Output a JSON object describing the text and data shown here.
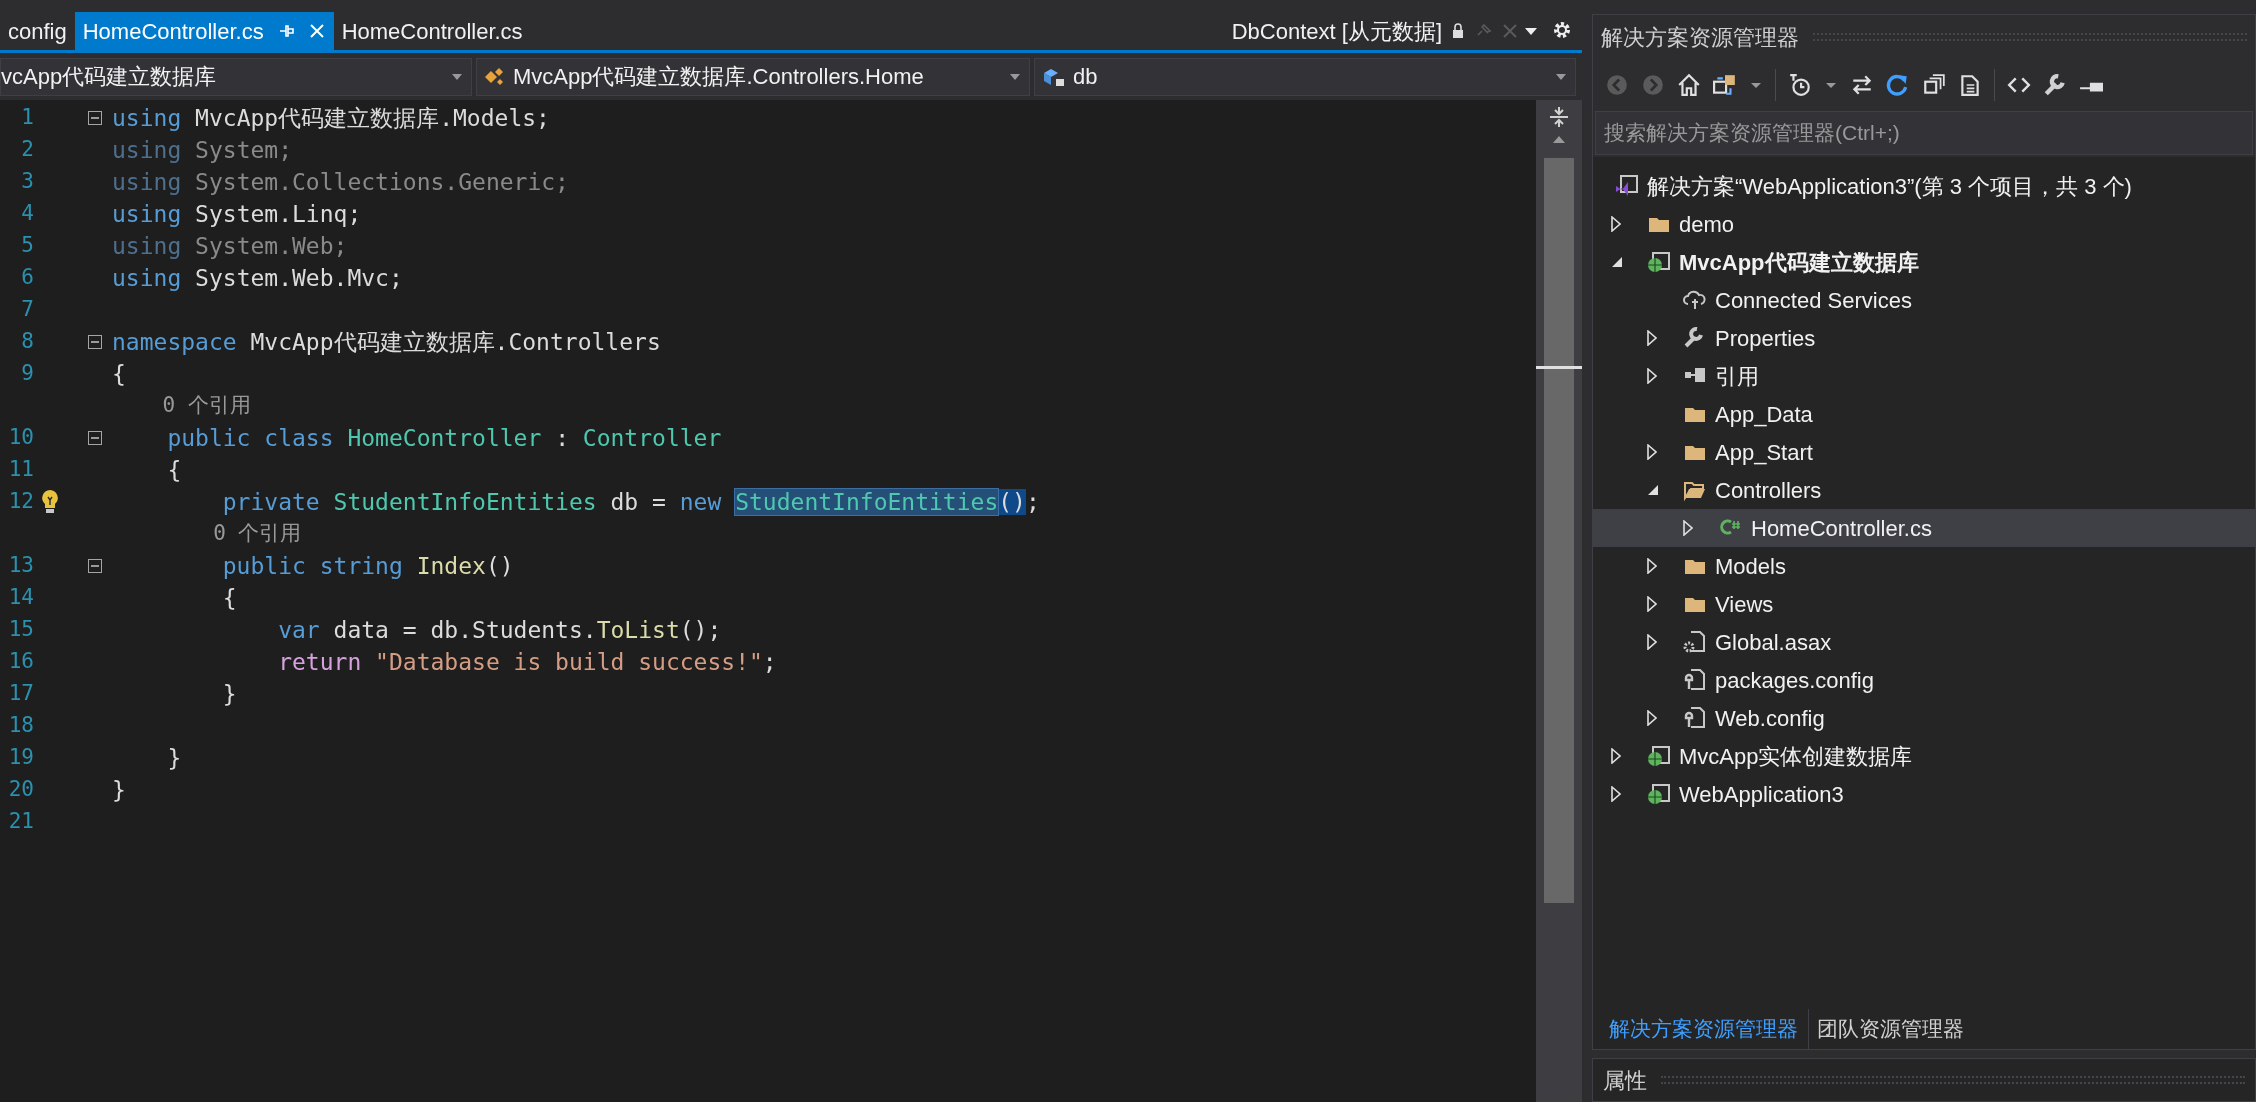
{
  "tabs": [
    {
      "label": "config",
      "selected": false,
      "pinned": false
    },
    {
      "label": "HomeController.cs",
      "selected": true,
      "pinned": true
    },
    {
      "label": "HomeController.cs",
      "selected": false,
      "pinned": false
    }
  ],
  "preview_tab": {
    "label": "DbContext [从元数据]"
  },
  "nav_bar": [
    {
      "label": "vcApp代码建立数据库",
      "kind": "project"
    },
    {
      "label": "MvcApp代码建立数据库.Controllers.Home",
      "kind": "class"
    },
    {
      "label": "db",
      "kind": "field"
    }
  ],
  "code": [
    {
      "kind": "code",
      "number": "1",
      "fold": true,
      "lightbulb": false,
      "tokens": [
        {
          "text": "using ",
          "kind": "keyword"
        },
        {
          "text": "MvcApp代码建立数据库.Models;",
          "kind": "plain"
        }
      ]
    },
    {
      "kind": "code",
      "number": "2",
      "fold": false,
      "lightbulb": false,
      "tokens": [
        {
          "text": "using ",
          "kind": "unusedkeyword"
        },
        {
          "text": "System;",
          "kind": "unused"
        }
      ]
    },
    {
      "kind": "code",
      "number": "3",
      "fold": false,
      "lightbulb": false,
      "tokens": [
        {
          "text": "using ",
          "kind": "unusedkeyword"
        },
        {
          "text": "System.Collections.Generic;",
          "kind": "unused"
        }
      ]
    },
    {
      "kind": "code",
      "number": "4",
      "fold": false,
      "lightbulb": false,
      "tokens": [
        {
          "text": "using ",
          "kind": "keyword"
        },
        {
          "text": "System.Linq;",
          "kind": "plain"
        }
      ]
    },
    {
      "kind": "code",
      "number": "5",
      "fold": false,
      "lightbulb": false,
      "tokens": [
        {
          "text": "using ",
          "kind": "unusedkeyword"
        },
        {
          "text": "System.Web;",
          "kind": "unused"
        }
      ]
    },
    {
      "kind": "code",
      "number": "6",
      "fold": false,
      "lightbulb": false,
      "tokens": [
        {
          "text": "using ",
          "kind": "keyword"
        },
        {
          "text": "System.Web.Mvc;",
          "kind": "plain"
        }
      ]
    },
    {
      "kind": "code",
      "number": "7",
      "fold": false,
      "lightbulb": false
    },
    {
      "kind": "code",
      "number": "8",
      "fold": true,
      "lightbulb": false,
      "tokens": [
        {
          "text": "namespace ",
          "kind": "keyword"
        },
        {
          "text": "MvcApp代码建立数据库.Controllers",
          "kind": "plain"
        }
      ]
    },
    {
      "kind": "code",
      "number": "9",
      "fold": false,
      "lightbulb": false,
      "tokens": [
        {
          "text": "{",
          "kind": "plain"
        }
      ]
    },
    {
      "kind": "lens",
      "text": "    0 个引用"
    },
    {
      "kind": "code",
      "number": "10",
      "fold": true,
      "lightbulb": false,
      "tokens": [
        {
          "text": "    public class ",
          "kind": "keyword"
        },
        {
          "text": "HomeController",
          "kind": "typename"
        },
        {
          "text": " : ",
          "kind": "plain"
        },
        {
          "text": "Controller",
          "kind": "typename"
        }
      ]
    },
    {
      "kind": "code",
      "number": "11",
      "fold": false,
      "lightbulb": false,
      "tokens": [
        {
          "text": "    {",
          "kind": "plain"
        }
      ]
    },
    {
      "kind": "code",
      "number": "12",
      "fold": false,
      "lightbulb": true,
      "tokens": [
        {
          "text": "        private ",
          "kind": "keyword"
        },
        {
          "text": "StudentInfoEntities",
          "kind": "typename"
        },
        {
          "text": " db = ",
          "kind": "plain"
        },
        {
          "text": "new ",
          "kind": "keyword"
        },
        {
          "text": "StudentInfoEntities",
          "kind": "typename",
          "highlighted": true
        },
        {
          "text": "()",
          "kind": "plain",
          "bracket_match": true
        },
        {
          "text": ";",
          "kind": "plain"
        }
      ]
    },
    {
      "kind": "lens",
      "text": "        0 个引用"
    },
    {
      "kind": "code",
      "number": "13",
      "fold": true,
      "lightbulb": false,
      "tokens": [
        {
          "text": "        public string ",
          "kind": "keyword"
        },
        {
          "text": "Index",
          "kind": "method"
        },
        {
          "text": "()",
          "kind": "plain"
        }
      ]
    },
    {
      "kind": "code",
      "number": "14",
      "fold": false,
      "lightbulb": false,
      "tokens": [
        {
          "text": "        {",
          "kind": "plain"
        }
      ]
    },
    {
      "kind": "code",
      "number": "15",
      "fold": false,
      "lightbulb": false,
      "tokens": [
        {
          "text": "            var ",
          "kind": "keyword"
        },
        {
          "text": "data = db.Students.",
          "kind": "plain"
        },
        {
          "text": "ToList",
          "kind": "method"
        },
        {
          "text": "();",
          "kind": "plain"
        }
      ]
    },
    {
      "kind": "code",
      "number": "16",
      "fold": false,
      "lightbulb": false,
      "tokens": [
        {
          "text": "            return ",
          "kind": "control"
        },
        {
          "text": "\"Database is build success!\"",
          "kind": "string"
        },
        {
          "text": ";",
          "kind": "plain"
        }
      ]
    },
    {
      "kind": "code",
      "number": "17",
      "fold": false,
      "lightbulb": false,
      "tokens": [
        {
          "text": "        }",
          "kind": "plain"
        }
      ]
    },
    {
      "kind": "code",
      "number": "18",
      "fold": false,
      "lightbulb": false
    },
    {
      "kind": "code",
      "number": "19",
      "fold": false,
      "lightbulb": false,
      "tokens": [
        {
          "text": "    }",
          "kind": "plain"
        }
      ]
    },
    {
      "kind": "code",
      "number": "20",
      "fold": false,
      "lightbulb": false,
      "tokens": [
        {
          "text": "}",
          "kind": "plain"
        }
      ]
    },
    {
      "kind": "code",
      "number": "21",
      "fold": false,
      "lightbulb": false
    }
  ],
  "solution_explorer": {
    "title": "解决方案资源管理器",
    "search": {
      "placeholder": "搜索解决方案资源管理器(Ctrl+;)"
    },
    "tree": [
      {
        "label": "解决方案“WebApplication3”(第 3 个项目，共 3 个)",
        "kind": "solution",
        "bold": false,
        "selected": false,
        "children": [
          {
            "label": "demo",
            "kind": "folder",
            "expandable": true,
            "expanded": false,
            "bold": false,
            "selected": false
          },
          {
            "label": "MvcApp代码建立数据库",
            "kind": "project",
            "expandable": true,
            "expanded": true,
            "bold": true,
            "selected": false,
            "children": [
              {
                "label": "Connected Services",
                "kind": "cloud",
                "expandable": false,
                "bold": false,
                "selected": false
              },
              {
                "label": "Properties",
                "kind": "wrench",
                "expandable": true,
                "expanded": false,
                "bold": false,
                "selected": false
              },
              {
                "label": "引用",
                "kind": "references",
                "expandable": true,
                "expanded": false,
                "bold": false,
                "selected": false
              },
              {
                "label": "App_Data",
                "kind": "folder",
                "expandable": false,
                "bold": false,
                "selected": false
              },
              {
                "label": "App_Start",
                "kind": "folder",
                "expandable": true,
                "expanded": false,
                "bold": false,
                "selected": false
              },
              {
                "label": "Controllers",
                "kind": "openfolder",
                "expandable": true,
                "expanded": true,
                "bold": false,
                "selected": false,
                "children": [
                  {
                    "label": "HomeController.cs",
                    "kind": "csharp",
                    "expandable": true,
                    "expanded": false,
                    "bold": false,
                    "selected": true
                  }
                ]
              },
              {
                "label": "Models",
                "kind": "folder",
                "expandable": true,
                "expanded": false,
                "bold": false,
                "selected": false
              },
              {
                "label": "Views",
                "kind": "folder",
                "expandable": true,
                "expanded": false,
                "bold": false,
                "selected": false
              },
              {
                "label": "Global.asax",
                "kind": "global",
                "expandable": true,
                "expanded": false,
                "bold": false,
                "selected": false
              },
              {
                "label": "packages.config",
                "kind": "config",
                "expandable": false,
                "bold": false,
                "selected": false
              },
              {
                "label": "Web.config",
                "kind": "config",
                "expandable": true,
                "expanded": false,
                "bold": false,
                "selected": false
              }
            ]
          },
          {
            "label": "MvcApp实体创建数据库",
            "kind": "project",
            "expandable": true,
            "expanded": false,
            "bold": false,
            "selected": false
          },
          {
            "label": "WebApplication3",
            "kind": "project",
            "expandable": true,
            "expanded": false,
            "bold": false,
            "selected": false
          }
        ]
      }
    ],
    "bottom_tabs": [
      {
        "label": "解决方案资源管理器",
        "selected": true
      },
      {
        "label": "团队资源管理器",
        "selected": false
      }
    ]
  },
  "properties": {
    "title": "属性"
  }
}
